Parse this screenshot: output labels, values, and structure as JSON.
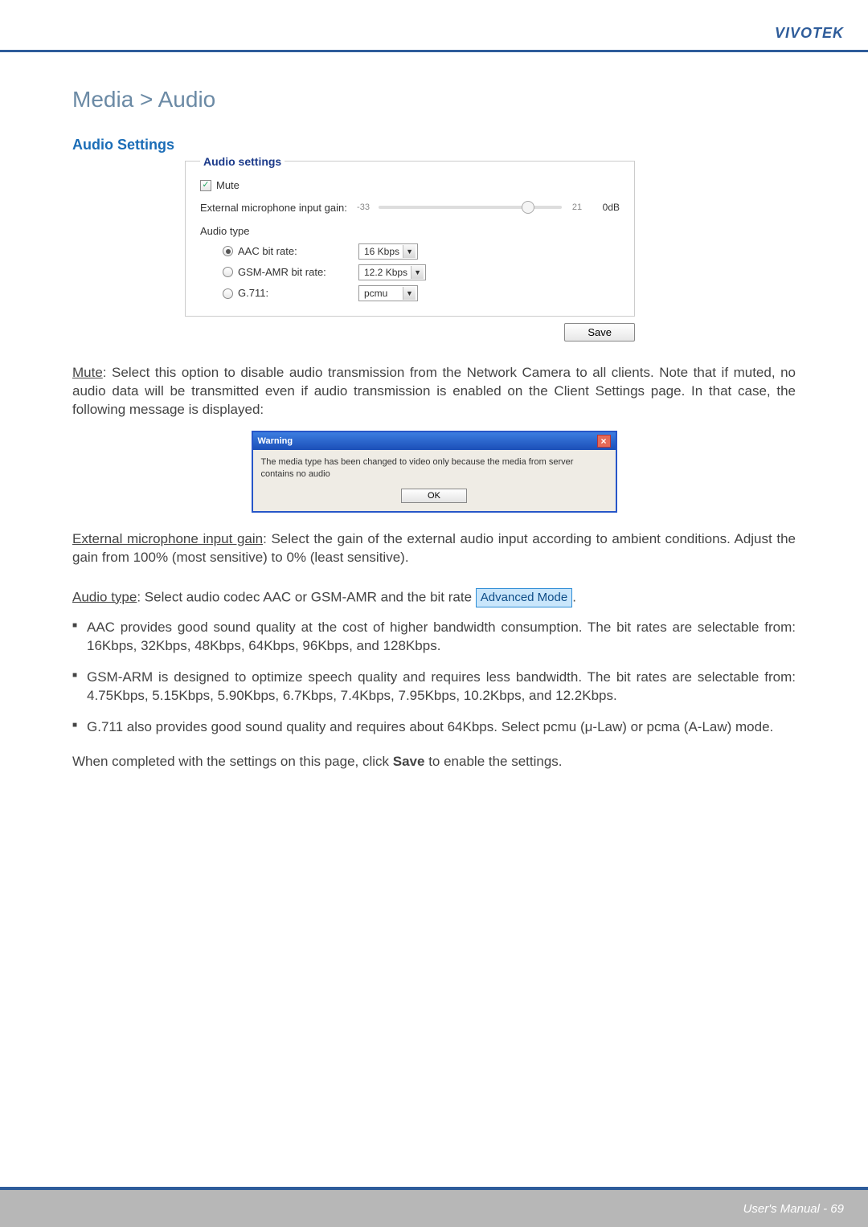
{
  "brand": "VIVOTEK",
  "breadcrumb": "Media > Audio",
  "section_title": "Audio Settings",
  "panel": {
    "legend": "Audio settings",
    "mute_label": "Mute",
    "mute_checked": true,
    "gain_label": "External microphone input gain:",
    "gain_min": "-33",
    "gain_max": "21",
    "gain_value": "0dB",
    "audio_type_label": "Audio type",
    "codecs": {
      "aac": {
        "label": "AAC bit rate:",
        "value": "16 Kbps",
        "selected": true
      },
      "gsmamr": {
        "label": "GSM-AMR bit rate:",
        "value": "12.2 Kbps",
        "selected": false
      },
      "g711": {
        "label": "G.711:",
        "value": "pcmu",
        "selected": false
      }
    },
    "save_label": "Save"
  },
  "para_mute": "Mute: Select this option to disable audio transmission from the Network Camera to all clients. Note that if muted, no audio data will be transmitted even if audio transmission is enabled on the Client Settings page. In that case, the following message is displayed:",
  "warning": {
    "title": "Warning",
    "message": "The media type has been changed to video only because the media from server contains no audio",
    "ok": "OK"
  },
  "para_gain": "External microphone input gain: Select the gain of the external audio input according to ambient conditions. Adjust the gain from 100% (most sensitive) to 0% (least sensitive).",
  "audio_type_intro_a": "Audio type",
  "audio_type_intro_b": ": Select audio codec AAC or GSM-AMR and the bit rate ",
  "adv_mode_label": "Advanced Mode",
  "audio_type_intro_c": ".",
  "bullets": {
    "aac": "AAC provides good sound quality at the cost of higher bandwidth consumption. The bit rates are selectable from: 16Kbps, 32Kbps, 48Kbps, 64Kbps, 96Kbps, and 128Kbps.",
    "gsm": "GSM-ARM is designed to optimize speech quality and requires less bandwidth. The bit rates are selectable from: 4.75Kbps, 5.15Kbps, 5.90Kbps, 6.7Kbps, 7.4Kbps, 7.95Kbps, 10.2Kbps, and 12.2Kbps.",
    "g711": "G.711 also provides good sound quality and requires about 64Kbps. Select pcmu (μ-Law) or pcma (A-Law) mode."
  },
  "para_save_a": "When completed with the settings on this page, click ",
  "para_save_b": "Save",
  "para_save_c": " to enable the settings.",
  "footer": "User's Manual - 69"
}
